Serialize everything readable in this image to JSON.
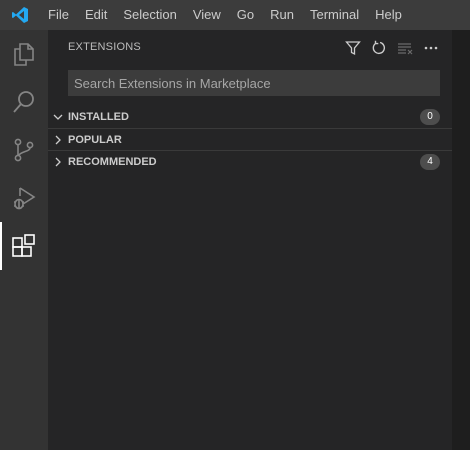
{
  "menu": {
    "items": [
      "File",
      "Edit",
      "Selection",
      "View",
      "Go",
      "Run",
      "Terminal",
      "Help"
    ]
  },
  "activity": {
    "items": [
      {
        "name": "files-icon",
        "active": false
      },
      {
        "name": "search-icon",
        "active": false
      },
      {
        "name": "source-control-icon",
        "active": false
      },
      {
        "name": "run-debug-icon",
        "active": false
      },
      {
        "name": "extensions-icon",
        "active": true
      }
    ]
  },
  "sidebar": {
    "title": "EXTENSIONS",
    "search_placeholder": "Search Extensions in Marketplace",
    "sections": [
      {
        "label": "INSTALLED",
        "badge": "0",
        "expanded": true
      },
      {
        "label": "POPULAR",
        "badge": null,
        "expanded": false
      },
      {
        "label": "RECOMMENDED",
        "badge": "4",
        "expanded": false
      }
    ]
  },
  "colors": {
    "titlebar": "#3c3c3c",
    "activitybar": "#333333",
    "sidebar": "#252526",
    "editor": "#1e1e1e",
    "vscode_logo": "#23a9f2"
  }
}
